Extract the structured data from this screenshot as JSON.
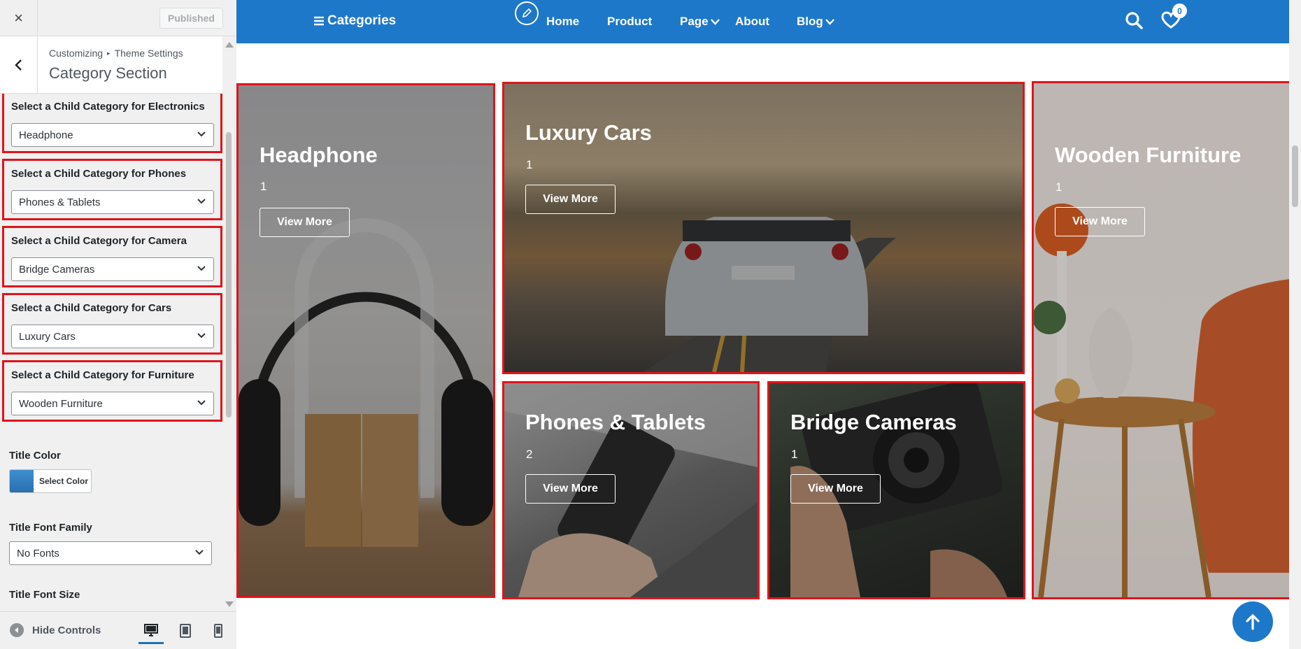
{
  "customizer": {
    "close_icon": "×",
    "publish_label": "Published",
    "breadcrumb_root": "Customizing",
    "breadcrumb_parent": "Theme Settings",
    "section_title": "Category Section",
    "controls": [
      {
        "label": "Select a Child Category for Electronics",
        "value": "Headphone"
      },
      {
        "label": "Select a Child Category for Phones",
        "value": "Phones & Tablets"
      },
      {
        "label": "Select a Child Category for Camera",
        "value": "Bridge Cameras"
      },
      {
        "label": "Select a Child Category for Cars",
        "value": "Luxury Cars"
      },
      {
        "label": "Select a Child Category for Furniture",
        "value": "Wooden Furniture"
      }
    ],
    "title_color_label": "Title Color",
    "select_color_label": "Select Color",
    "title_font_family_label": "Title Font Family",
    "title_font_family_value": "No Fonts",
    "title_font_size_label": "Title Font Size",
    "hide_controls_label": "Hide Controls",
    "devices": [
      "desktop-icon",
      "tablet-icon",
      "mobile-icon"
    ]
  },
  "site": {
    "nav": {
      "categories_label": "Categories",
      "items": [
        "Home",
        "Product",
        "Page",
        "About",
        "Blog"
      ],
      "wishlist_count": "0"
    },
    "cards": [
      {
        "title": "Headphone",
        "count": "1",
        "button": "View More"
      },
      {
        "title": "Luxury Cars",
        "count": "1",
        "button": "View More"
      },
      {
        "title": "Wooden Furniture",
        "count": "1",
        "button": "View More"
      },
      {
        "title": "Phones & Tablets",
        "count": "2",
        "button": "View More"
      },
      {
        "title": "Bridge Cameras",
        "count": "1",
        "button": "View More"
      }
    ]
  },
  "colors": {
    "accent": "#1e78c9",
    "highlight": "#e0141b"
  }
}
